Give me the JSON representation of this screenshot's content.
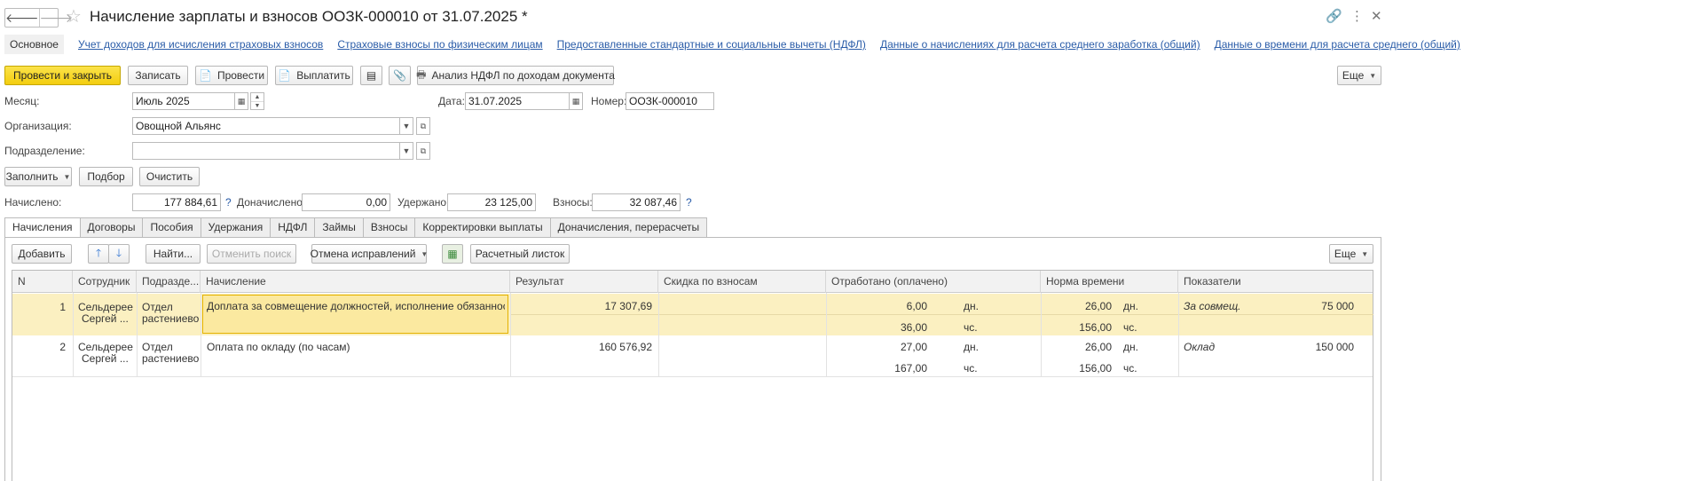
{
  "title": "Начисление зарплаты и взносов ООЗК-000010 от 31.07.2025 *",
  "nav": {
    "back": "🡐",
    "forward": "🡒"
  },
  "titlebar_icons": {
    "link": "🔗",
    "more": "⋮",
    "close": "✕"
  },
  "sections": [
    "Основное",
    "Учет доходов для исчисления страховых взносов",
    "Страховые взносы по физическим лицам",
    "Предоставленные стандартные и социальные вычеты (НДФЛ)",
    "Данные о начислениях для расчета среднего заработка (общий)",
    "Данные о времени для расчета среднего (общий)"
  ],
  "toolbar": {
    "post_close": "Провести и закрыть",
    "save": "Записать",
    "post": "Провести",
    "pay": "Выплатить",
    "ndfl_analysis": "Анализ НДФЛ по доходам документа",
    "more": "Еще"
  },
  "form": {
    "month_label": "Месяц:",
    "month_value": "Июль 2025",
    "date_label": "Дата:",
    "date_value": "31.07.2025",
    "number_label": "Номер:",
    "number_value": "ООЗК-000010",
    "org_label": "Организация:",
    "org_value": "Овощной Альянс",
    "dept_label": "Подразделение:",
    "dept_value": ""
  },
  "actions": {
    "fill": "Заполнить",
    "select": "Подбор",
    "clear": "Очистить"
  },
  "totals": {
    "accrued_label": "Начислено:",
    "accrued_value": "177 884,61",
    "extra_label": "Доначислено:",
    "extra_value": "0,00",
    "withheld_label": "Удержано:",
    "withheld_value": "23 125,00",
    "contrib_label": "Взносы:",
    "contrib_value": "32 087,46",
    "q": "?"
  },
  "tabs": [
    "Начисления",
    "Договоры",
    "Пособия",
    "Удержания",
    "НДФЛ",
    "Займы",
    "Взносы",
    "Корректировки выплаты",
    "Доначисления, перерасчеты"
  ],
  "grid_toolbar": {
    "add": "Добавить",
    "find": "Найти...",
    "cancel_search": "Отменить поиск",
    "cancel_fixes": "Отмена исправлений",
    "payslip": "Расчетный листок",
    "more": "Еще"
  },
  "columns": [
    "N",
    "Сотрудник",
    "Подразде...",
    "Начисление",
    "Результат",
    "Скидка по взносам",
    "Отработано (оплачено)",
    "Норма времени",
    "Показатели"
  ],
  "rows": [
    {
      "n": "1",
      "emp1": "Сельдерее",
      "emp2": "Сергей ...",
      "dep1": "Отдел",
      "dep2": "растениево",
      "accrual": "Доплата за совмещение должностей, исполнение обязанностей",
      "result": "17 307,69",
      "worked_days": "6,00",
      "worked_days_unit": "дн.",
      "worked_hours": "36,00",
      "worked_hours_unit": "чс.",
      "norm_days": "26,00",
      "norm_days_unit": "дн.",
      "norm_hours": "156,00",
      "norm_hours_unit": "чс.",
      "indicator": "За совмещ.",
      "indicator_value": "75 000"
    },
    {
      "n": "2",
      "emp1": "Сельдерее",
      "emp2": "Сергей ...",
      "dep1": "Отдел",
      "dep2": "растениево",
      "accrual": "Оплата по окладу (по часам)",
      "result": "160 576,92",
      "worked_days": "27,00",
      "worked_days_unit": "дн.",
      "worked_hours": "167,00",
      "worked_hours_unit": "чс.",
      "norm_days": "26,00",
      "norm_days_unit": "дн.",
      "norm_hours": "156,00",
      "norm_hours_unit": "чс.",
      "indicator": "Оклад",
      "indicator_value": "150 000"
    }
  ]
}
